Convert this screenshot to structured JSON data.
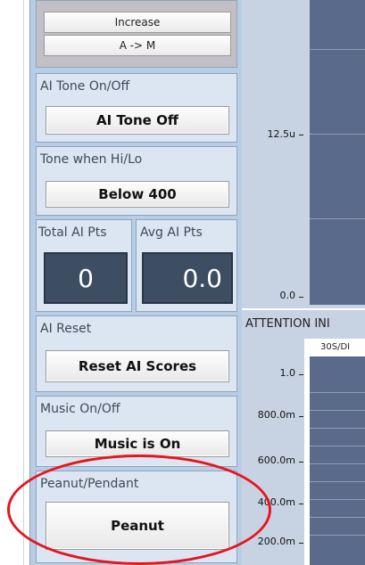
{
  "sort_controls": {
    "increase_label": "Increase",
    "order_label": "A -> M"
  },
  "ai_tone": {
    "label": "AI Tone On/Off",
    "button": "AI Tone Off"
  },
  "tone_threshold": {
    "label": "Tone when Hi/Lo",
    "button": "Below 400"
  },
  "ai_points": {
    "total_label": "Total AI Pts",
    "avg_label": "Avg AI Pts",
    "total_value": "0",
    "avg_value": "0.0"
  },
  "ai_reset": {
    "label": "AI Reset",
    "button": "Reset AI Scores"
  },
  "music": {
    "label": "Music On/Off",
    "button": "Music is On"
  },
  "peanut_pendant": {
    "label": "Peanut/Pendant",
    "button": "Peanut"
  },
  "top_chart": {
    "ticks": [
      "12.5u",
      "0.0"
    ]
  },
  "attention_chart": {
    "title": "ATTENTION INI",
    "series_label": "30S/DI",
    "ticks": [
      "1.0",
      "800.0m",
      "600.0m",
      "400.0m",
      "200.0m"
    ]
  },
  "colors": {
    "panel": "#b8cde3",
    "plot": "#5a6a8a",
    "annotation": "#e8141c"
  }
}
